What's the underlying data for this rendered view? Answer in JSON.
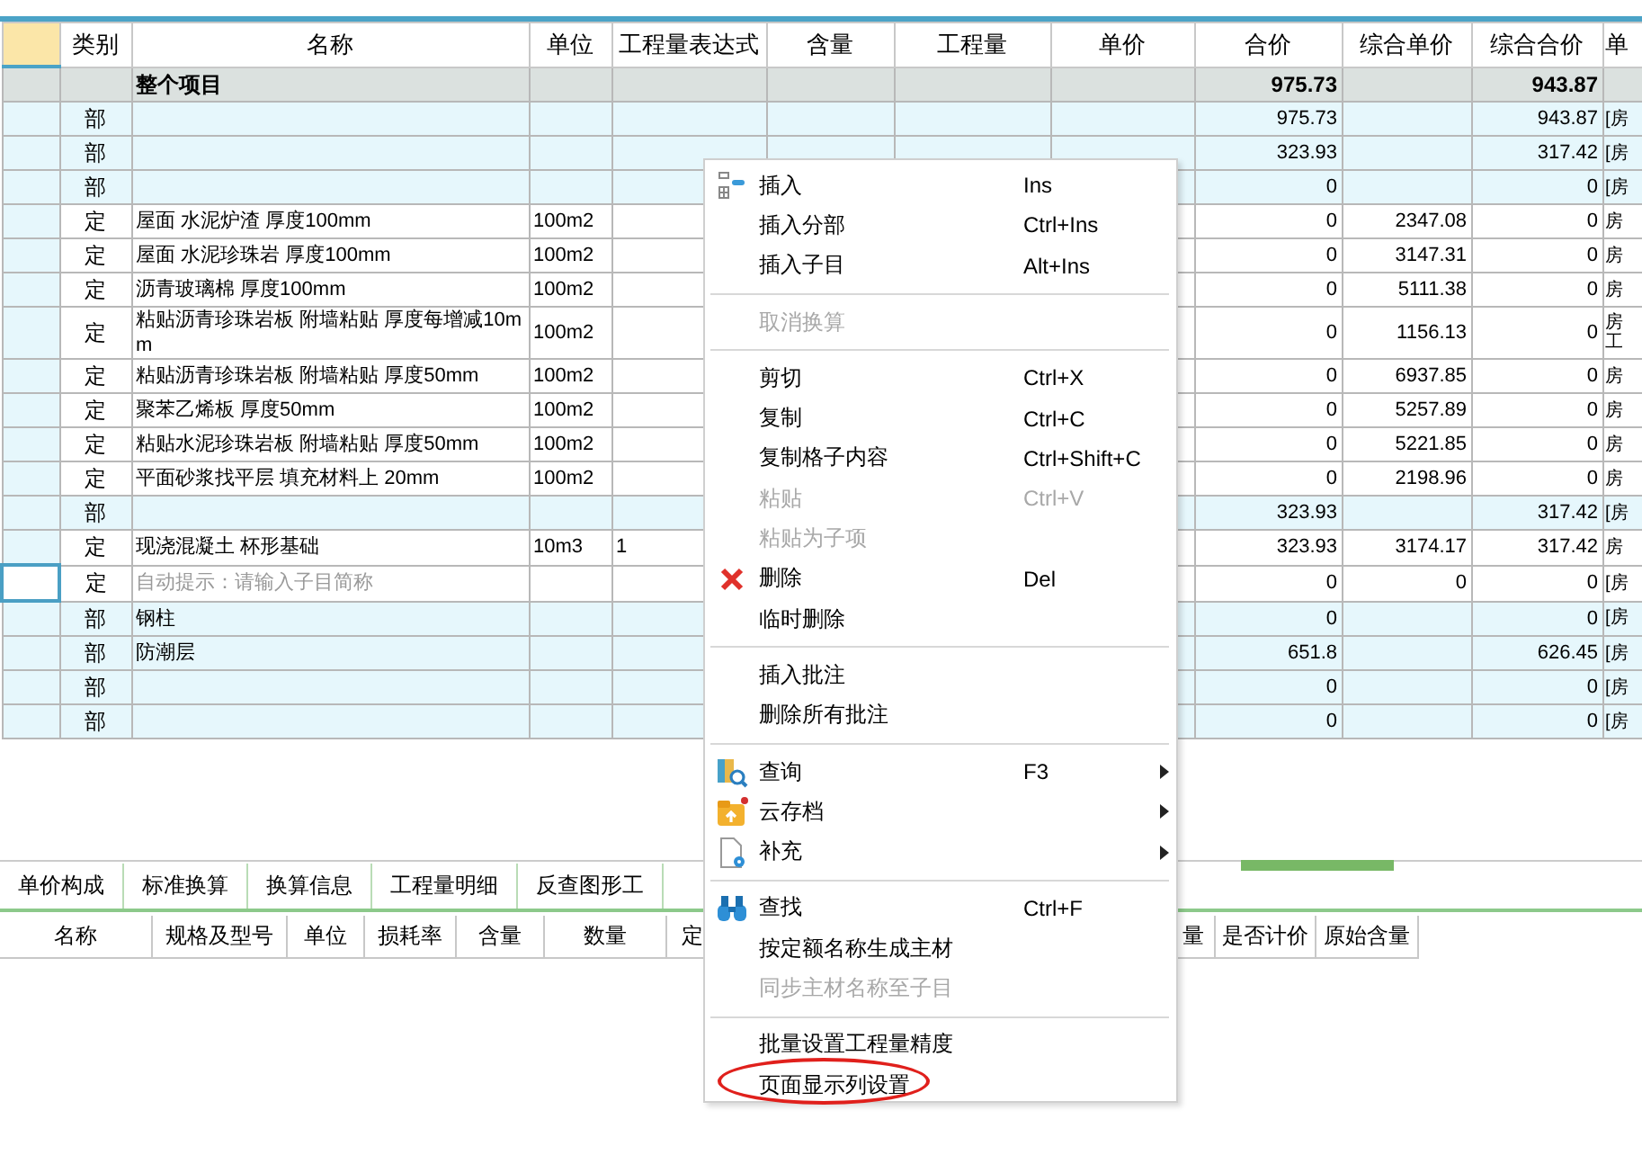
{
  "table": {
    "columns": [
      "类别",
      "名称",
      "单位",
      "工程量表达式",
      "含量",
      "工程量",
      "单价",
      "合价",
      "综合单价",
      "综合合价",
      "单"
    ],
    "rows": [
      {
        "kind": "total",
        "focused": false,
        "hint": false,
        "name": "整个项目",
        "total": "975.73",
        "composite_total": "943.87"
      },
      {
        "kind": "group",
        "focused": false,
        "hint": false,
        "category": "部",
        "total": "975.73",
        "composite_total": "943.87",
        "column_12": "[房"
      },
      {
        "kind": "group",
        "focused": false,
        "hint": false,
        "category": "部",
        "total": "323.93",
        "composite_total": "317.42",
        "column_12": "[房"
      },
      {
        "kind": "group",
        "focused": false,
        "hint": false,
        "category": "部",
        "total": "0",
        "composite_total": "0",
        "column_12": "[房"
      },
      {
        "kind": "item",
        "focused": false,
        "hint": false,
        "category": "定",
        "name": "屋面 水泥炉渣 厚度100mm",
        "unit": "100m2",
        "total": "0",
        "composite_unit_price": "2347.08",
        "composite_total": "0",
        "column_12": "房"
      },
      {
        "kind": "item",
        "focused": false,
        "hint": false,
        "category": "定",
        "name": "屋面 水泥珍珠岩 厚度100mm",
        "unit": "100m2",
        "total": "0",
        "composite_unit_price": "3147.31",
        "composite_total": "0",
        "column_12": "房"
      },
      {
        "kind": "item",
        "focused": false,
        "hint": false,
        "category": "定",
        "name": "沥青玻璃棉 厚度100mm",
        "unit": "100m2",
        "total": "0",
        "composite_unit_price": "5111.38",
        "composite_total": "0",
        "column_12": "房"
      },
      {
        "kind": "item",
        "focused": false,
        "hint": false,
        "category": "定",
        "name": "粘贴沥青珍珠岩板 附墙粘贴 厚度每增减10mm",
        "unit": "100m2",
        "total": "0",
        "composite_unit_price": "1156.13",
        "composite_total": "0",
        "column_12": "房工"
      },
      {
        "kind": "item",
        "focused": false,
        "hint": false,
        "category": "定",
        "name": "粘贴沥青珍珠岩板 附墙粘贴 厚度50mm",
        "unit": "100m2",
        "total": "0",
        "composite_unit_price": "6937.85",
        "composite_total": "0",
        "column_12": "房"
      },
      {
        "kind": "item",
        "focused": false,
        "hint": false,
        "category": "定",
        "name": "聚苯乙烯板 厚度50mm",
        "unit": "100m2",
        "total": "0",
        "composite_unit_price": "5257.89",
        "composite_total": "0",
        "column_12": "房"
      },
      {
        "kind": "item",
        "focused": false,
        "hint": false,
        "category": "定",
        "name": "粘贴水泥珍珠岩板 附墙粘贴 厚度50mm",
        "unit": "100m2",
        "total": "0",
        "composite_unit_price": "5221.85",
        "composite_total": "0",
        "column_12": "房"
      },
      {
        "kind": "item",
        "focused": false,
        "hint": false,
        "category": "定",
        "name": "平面砂浆找平层 填充材料上 20mm",
        "unit": "100m2",
        "total": "0",
        "composite_unit_price": "2198.96",
        "composite_total": "0",
        "column_12": "房"
      },
      {
        "kind": "group",
        "focused": false,
        "hint": false,
        "category": "部",
        "total": "323.93",
        "composite_total": "317.42",
        "column_12": "[房"
      },
      {
        "kind": "item",
        "focused": false,
        "hint": false,
        "category": "定",
        "name": "现浇混凝土 杯形基础",
        "unit": "10m3",
        "expression": "1",
        "total": "323.93",
        "composite_unit_price": "3174.17",
        "composite_total": "317.42",
        "column_12": "房"
      },
      {
        "kind": "item",
        "focused": true,
        "hint": true,
        "category": "定",
        "name": "自动提示：请输入子目简称",
        "total": "0",
        "composite_unit_price": "0",
        "composite_total": "0",
        "column_12": "[房"
      },
      {
        "kind": "group",
        "focused": false,
        "hint": false,
        "category": "部",
        "name": "钢柱",
        "total": "0",
        "composite_total": "0",
        "column_12": "[房"
      },
      {
        "kind": "group",
        "focused": false,
        "hint": false,
        "category": "部",
        "name": "防潮层",
        "total": "651.8",
        "composite_total": "626.45",
        "column_12": "[房"
      },
      {
        "kind": "group",
        "focused": false,
        "hint": false,
        "category": "部",
        "total": "0",
        "composite_total": "0",
        "column_12": "[房"
      },
      {
        "kind": "group",
        "focused": false,
        "hint": false,
        "category": "部",
        "total": "0",
        "composite_total": "0",
        "column_12": "[房"
      }
    ]
  },
  "bottom_tabs": [
    {
      "label": "单价构成",
      "selected": false
    },
    {
      "label": "标准换算",
      "selected": false
    },
    {
      "label": "换算信息",
      "selected": false
    },
    {
      "label": "工程量明细",
      "selected": false
    },
    {
      "label": "反查图形工",
      "selected": false
    }
  ],
  "sub_table": {
    "columns": [
      "名称",
      "规格及型号",
      "单位",
      "损耗率",
      "含量",
      "数量",
      "定",
      "量",
      "是否计价",
      "原始含量"
    ]
  },
  "context_menu": {
    "groups": [
      [
        {
          "label": "插入",
          "shortcut": "Ins",
          "kind": "insert",
          "disabled": false,
          "submenu": false,
          "circled": false
        },
        {
          "label": "插入分部",
          "shortcut": "Ctrl+Ins",
          "disabled": false,
          "submenu": false,
          "circled": false
        },
        {
          "label": "插入子目",
          "shortcut": "Alt+Ins",
          "disabled": false,
          "submenu": false,
          "circled": false
        }
      ],
      [
        {
          "label": "取消换算",
          "disabled": true,
          "submenu": false,
          "circled": false
        }
      ],
      [
        {
          "label": "剪切",
          "shortcut": "Ctrl+X",
          "disabled": false,
          "submenu": false,
          "circled": false
        },
        {
          "label": "复制",
          "shortcut": "Ctrl+C",
          "disabled": false,
          "submenu": false,
          "circled": false
        },
        {
          "label": "复制格子内容",
          "shortcut": "Ctrl+Shift+C",
          "disabled": false,
          "submenu": false,
          "circled": false
        },
        {
          "label": "粘贴",
          "shortcut": "Ctrl+V",
          "disabled": true,
          "submenu": false,
          "circled": false
        },
        {
          "label": "粘贴为子项",
          "disabled": true,
          "submenu": false,
          "circled": false
        },
        {
          "label": "删除",
          "shortcut": "Del",
          "kind": "delete",
          "disabled": false,
          "submenu": false,
          "circled": false
        },
        {
          "label": "临时删除",
          "disabled": false,
          "submenu": false,
          "circled": false
        }
      ],
      [
        {
          "label": "插入批注",
          "disabled": false,
          "submenu": false,
          "circled": false
        },
        {
          "label": "删除所有批注",
          "disabled": false,
          "submenu": false,
          "circled": false
        }
      ],
      [
        {
          "label": "查询",
          "shortcut": "F3",
          "kind": "query",
          "disabled": false,
          "submenu": true,
          "circled": false
        },
        {
          "label": "云存档",
          "kind": "cloud",
          "disabled": false,
          "submenu": true,
          "circled": false
        },
        {
          "label": "补充",
          "kind": "supplement",
          "disabled": false,
          "submenu": true,
          "circled": false
        }
      ],
      [
        {
          "label": "查找",
          "shortcut": "Ctrl+F",
          "kind": "find",
          "disabled": false,
          "submenu": false,
          "circled": false
        },
        {
          "label": "按定额名称生成主材",
          "disabled": false,
          "submenu": false,
          "circled": false
        },
        {
          "label": "同步主材名称至子目",
          "disabled": true,
          "submenu": false,
          "circled": false
        }
      ],
      [
        {
          "label": "批量设置工程量精度",
          "disabled": false,
          "submenu": false,
          "circled": false
        },
        {
          "label": "页面显示列设置",
          "disabled": false,
          "submenu": false,
          "circled": true
        }
      ]
    ]
  }
}
